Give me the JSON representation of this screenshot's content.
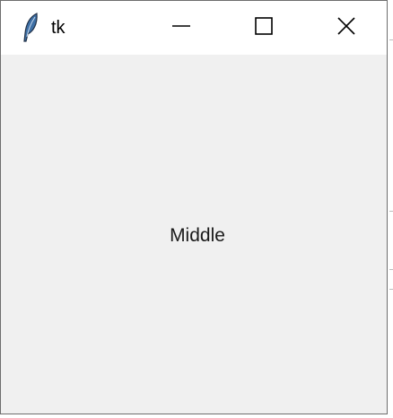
{
  "window": {
    "title": "tk",
    "icon": "tk-feather-icon",
    "controls": {
      "minimize_icon": "minimize-icon",
      "maximize_icon": "maximize-icon",
      "close_icon": "close-icon"
    }
  },
  "content": {
    "label": "Middle"
  },
  "colors": {
    "titlebar": "#ffffff",
    "client_background": "#f0f0f0",
    "border": "#6e6e6e",
    "text": "#1a1a1a"
  }
}
